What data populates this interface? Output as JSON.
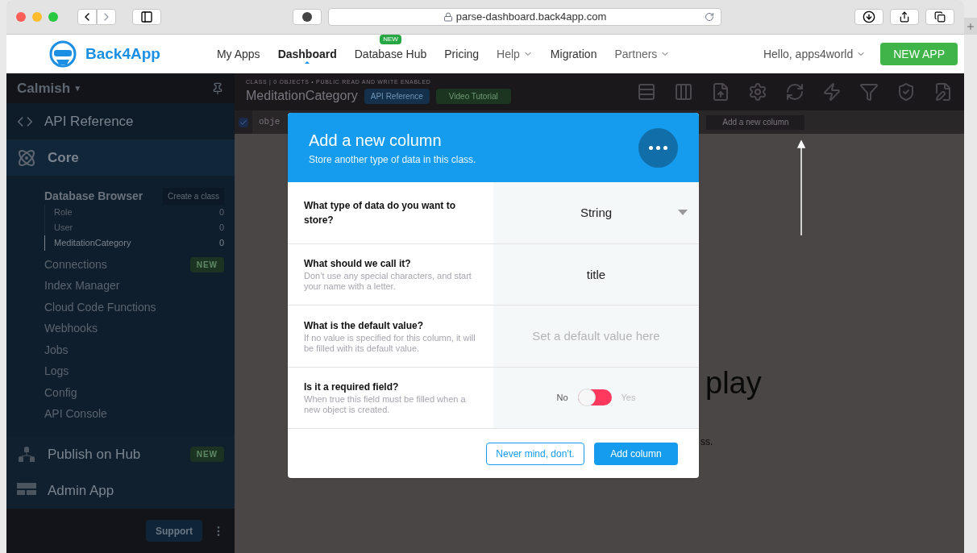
{
  "browser": {
    "url": "parse-dashboard.back4app.com"
  },
  "nav": {
    "brand": "Back4App",
    "links": [
      {
        "label": "My Apps",
        "selected": false,
        "dropdown": false
      },
      {
        "label": "Dashboard",
        "selected": true,
        "dropdown": false
      },
      {
        "label": "Database Hub",
        "selected": false,
        "dropdown": false,
        "badge": "NEW"
      },
      {
        "label": "Pricing",
        "selected": false,
        "dropdown": false
      },
      {
        "label": "Help",
        "selected": false,
        "dropdown": true
      },
      {
        "label": "Migration",
        "selected": false,
        "dropdown": false
      },
      {
        "label": "Partners",
        "selected": false,
        "dropdown": true
      }
    ],
    "greeting": "Hello, apps4world",
    "new_app": "NEW APP"
  },
  "sidebar": {
    "app_name": "Calmish",
    "app_caret": "▼",
    "items": [
      {
        "kind": "section",
        "label": "API Reference",
        "selected": false
      },
      {
        "kind": "section",
        "label": "Core",
        "selected": true,
        "children": [
          {
            "kind": "group",
            "label": "Database Browser",
            "action": "Create a class",
            "children": [
              {
                "label": "Role",
                "count": "0",
                "selected": false
              },
              {
                "label": "User",
                "count": "0",
                "selected": false
              },
              {
                "label": "MeditationCategory",
                "count": "0",
                "selected": true
              }
            ]
          },
          {
            "kind": "link",
            "label": "Connections",
            "badge": "NEW"
          },
          {
            "kind": "link",
            "label": "Index Manager"
          },
          {
            "kind": "link",
            "label": "Cloud Code Functions"
          },
          {
            "kind": "link",
            "label": "Webhooks"
          },
          {
            "kind": "link",
            "label": "Jobs"
          },
          {
            "kind": "link",
            "label": "Logs"
          },
          {
            "kind": "link",
            "label": "Config"
          },
          {
            "kind": "link",
            "label": "API Console"
          }
        ]
      },
      {
        "kind": "section",
        "label": "Publish on Hub",
        "selected": false,
        "badge": "NEW"
      },
      {
        "kind": "section",
        "label": "Admin App",
        "selected": false
      }
    ],
    "support": "Support"
  },
  "content": {
    "class_info": "CLASS | 0 OBJECTS • PUBLIC READ AND WRITE ENABLED",
    "class_name": "MeditationCategory",
    "api_reference": "API Reference",
    "video_tutorial": "Video Tutorial",
    "select_all_checked": true,
    "column_1": "obje",
    "add_column": "Add a new column",
    "background_text_1": "play",
    "background_text_2": "ss."
  },
  "modal": {
    "title": "Add a new column",
    "subtitle": "Store another type of data in this class.",
    "rows": [
      {
        "kind": "select",
        "label": "What type of data do you want to store?",
        "value": "String"
      },
      {
        "kind": "text",
        "label": "What should we call it?",
        "help": "Don’t use any special characters, and start your name with a letter.",
        "value": "title"
      },
      {
        "kind": "text",
        "label": "What is the default value?",
        "help": "If no value is specified for this column, it will be filled with its default value.",
        "placeholder": "Set a default value here"
      },
      {
        "kind": "toggle",
        "label": "Is it a required field?",
        "help": "When true this field must be filled when a new object is created.",
        "off_label": "No",
        "on_label": "Yes",
        "on": false
      }
    ],
    "cancel": "Never mind, don’t.",
    "submit": "Add column"
  }
}
